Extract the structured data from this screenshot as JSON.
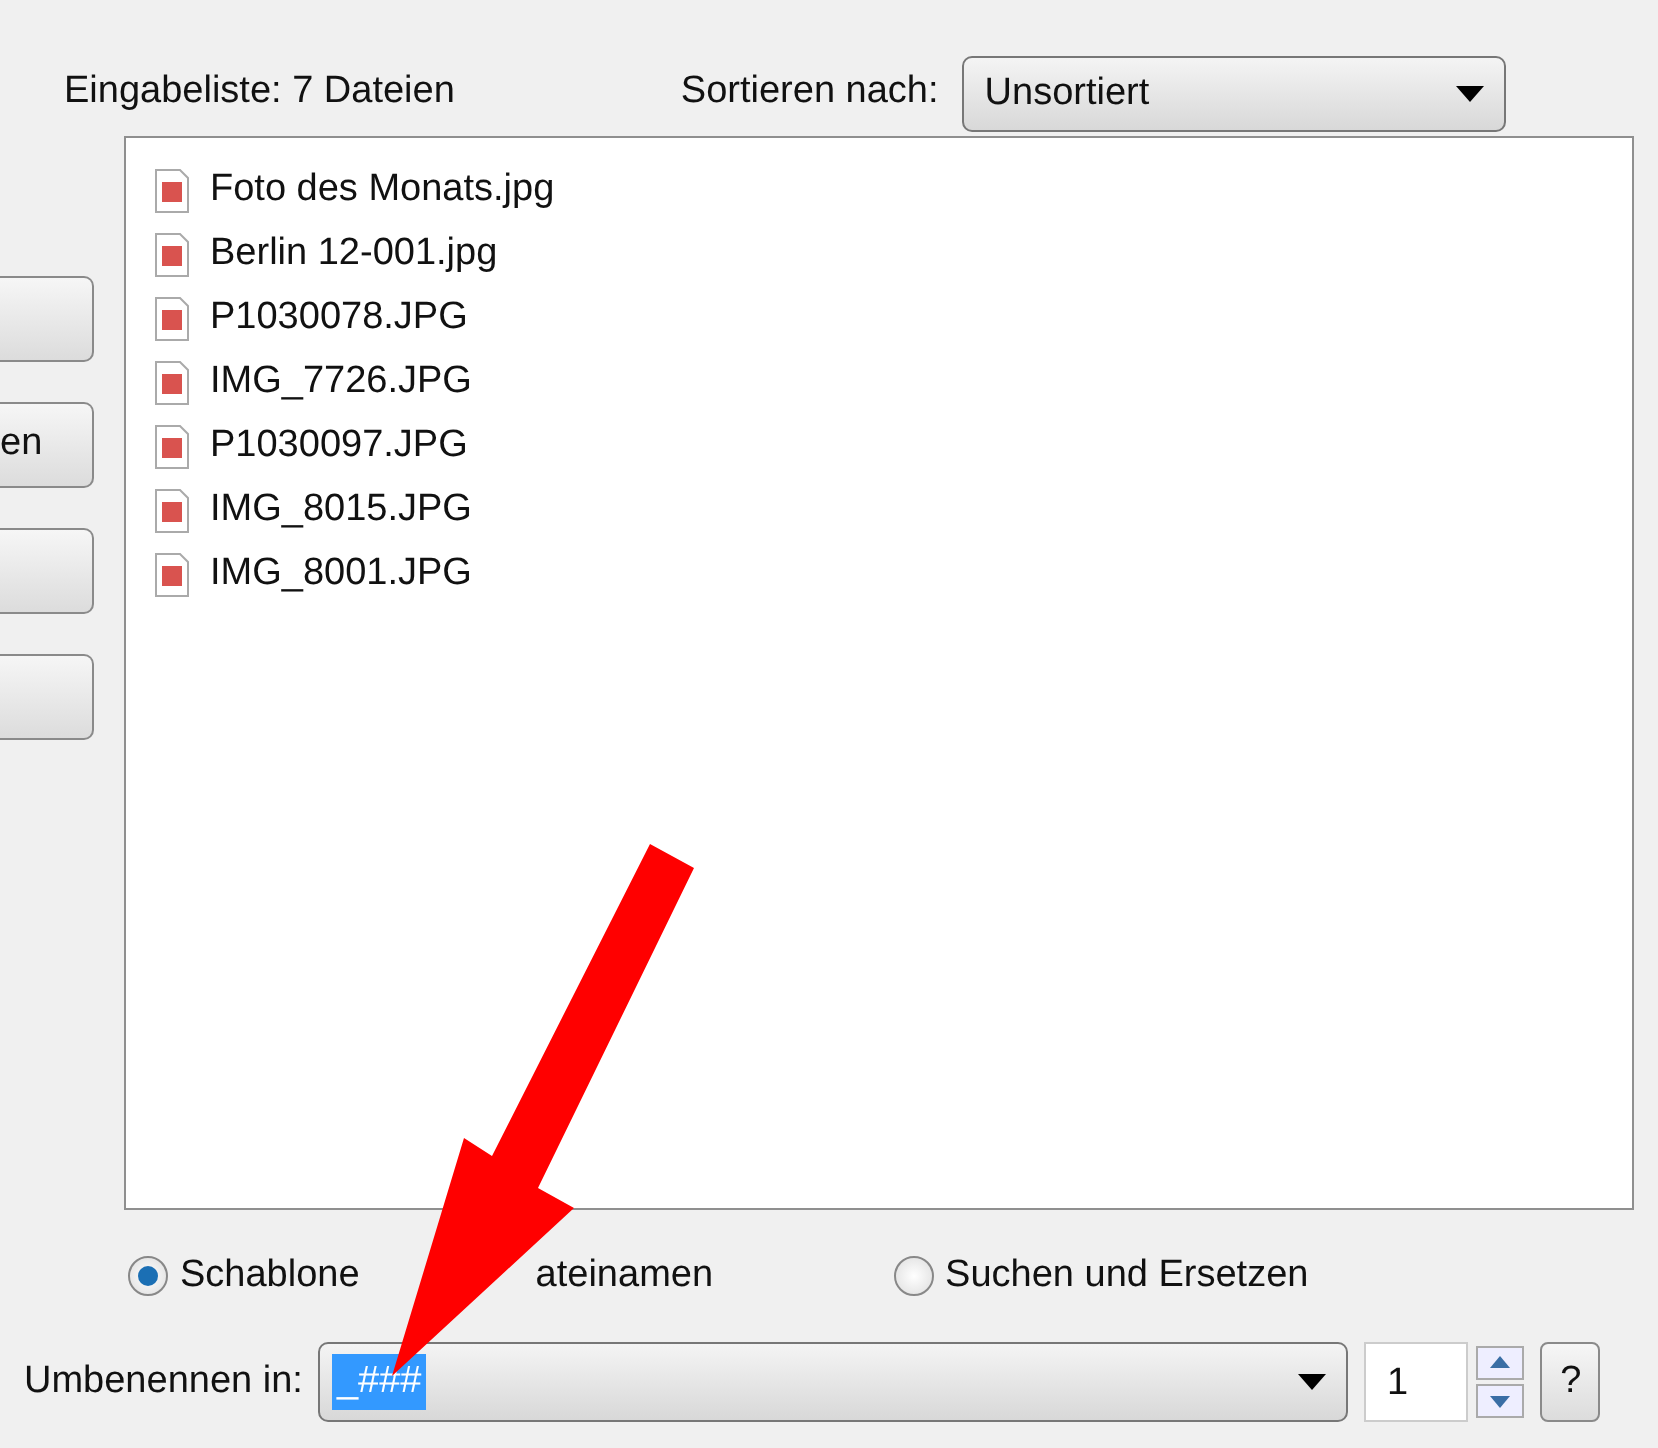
{
  "input_list": {
    "label": "Eingabeliste: 7 Dateien"
  },
  "sort": {
    "label": "Sortieren nach:",
    "value": "Unsortiert"
  },
  "side_buttons": [
    {
      "kind": "button"
    },
    {
      "kind": "button",
      "label": "en"
    },
    {
      "kind": "button"
    },
    {
      "kind": "button"
    }
  ],
  "files": [
    {
      "name": "Foto des Monats.jpg"
    },
    {
      "name": "Berlin 12-001.jpg"
    },
    {
      "name": "P1030078.JPG"
    },
    {
      "name": "IMG_7726.JPG"
    },
    {
      "name": "P1030097.JPG"
    },
    {
      "name": "IMG_8015.JPG"
    },
    {
      "name": "IMG_8001.JPG"
    }
  ],
  "modes": [
    {
      "label_parts": [
        "Schablone",
        "ateinamen"
      ],
      "selected": true
    },
    {
      "label_parts": [
        "Suchen und Ersetzen"
      ],
      "selected": false
    }
  ],
  "rename": {
    "label": "Umbenennen in:",
    "value": "_###",
    "counter": "1",
    "help": "?"
  }
}
